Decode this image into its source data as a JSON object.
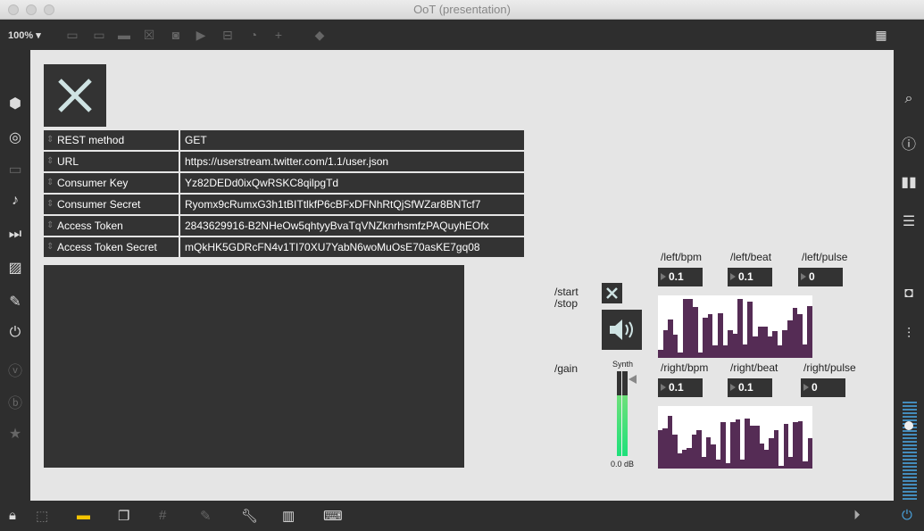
{
  "window": {
    "title": "OoT (presentation)"
  },
  "toolbar": {
    "zoom": "100%"
  },
  "auth": {
    "rows": [
      {
        "key": "REST method",
        "value": "GET"
      },
      {
        "key": "URL",
        "value": "https://userstream.twitter.com/1.1/user.json"
      },
      {
        "key": "Consumer Key",
        "value": "Yz82DEDd0ixQwRSKC8qilpgTd"
      },
      {
        "key": "Consumer Secret",
        "value": "Ryomx9cRumxG3h1tBITtlkfP6cBFxDFNhRtQjSfWZar8BNTcf7"
      },
      {
        "key": "Access Token",
        "value": "2843629916-B2NHeOw5qhtyyBvaTqVNZknrhsmfzPAQuyhEOfx"
      },
      {
        "key": "Access Token Secret",
        "value": "mQkHK5GDRcFN4v1TI70XU7YabN6woMuOsE70asKE7gq08"
      }
    ]
  },
  "controls": {
    "start_stop_1": "/start",
    "start_stop_2": "/stop",
    "gain": "/gain",
    "synth": "Synth",
    "db": "0.0 dB",
    "gain_level": 0.72
  },
  "left": {
    "labels": [
      "/left/bpm",
      "/left/beat",
      "/left/pulse"
    ],
    "values": [
      "0.1",
      "0.1",
      "0"
    ],
    "bars": [
      0.13,
      0.45,
      0.61,
      0.37,
      0.08,
      0.94,
      0.94,
      0.81,
      0.08,
      0.65,
      0.7,
      0.2,
      0.72,
      0.2,
      0.45,
      0.38,
      0.95,
      0.22,
      0.9,
      0.35,
      0.5,
      0.5,
      0.35,
      0.43,
      0.2,
      0.45,
      0.6,
      0.8,
      0.7,
      0.22,
      0.83
    ]
  },
  "right": {
    "labels": [
      "/right/bpm",
      "/right/beat",
      "/right/pulse"
    ],
    "values": [
      "0.1",
      "0.1",
      "0"
    ],
    "bars": [
      0.62,
      0.64,
      0.85,
      0.55,
      0.25,
      0.3,
      0.33,
      0.55,
      0.62,
      0.18,
      0.5,
      0.38,
      0.15,
      0.74,
      0.08,
      0.75,
      0.78,
      0.15,
      0.8,
      0.68,
      0.68,
      0.4,
      0.3,
      0.48,
      0.62,
      0.05,
      0.72,
      0.18,
      0.74,
      0.76,
      0.12,
      0.48
    ]
  },
  "colors": {
    "bar": "#552c55",
    "panel": "#333333",
    "canvas": "#e5e5e5"
  }
}
